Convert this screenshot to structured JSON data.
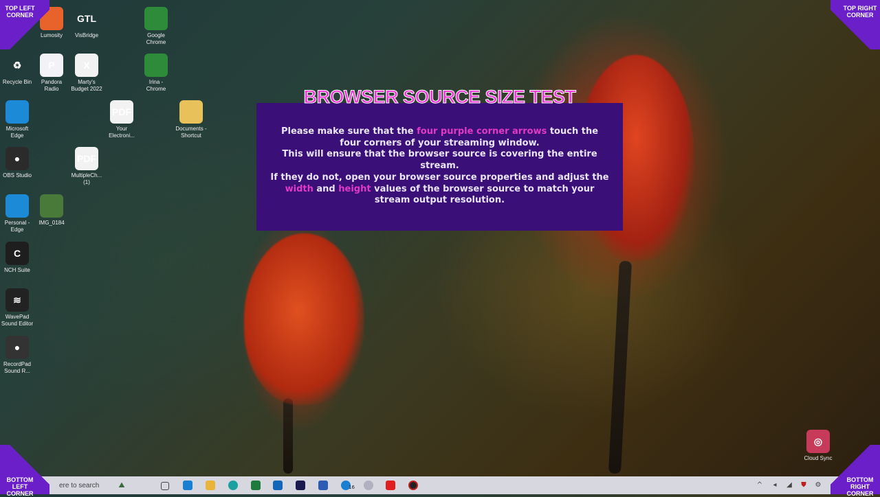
{
  "desktop_icons": [
    {
      "label": "Lumosity",
      "color": "#e8622b",
      "glyph": ""
    },
    {
      "label": "VisBridge",
      "color": "rgba(0,0,0,0)",
      "glyph": "GTL"
    },
    {
      "label": "Google Chrome",
      "color": "#2e8b3a",
      "glyph": ""
    },
    {
      "label": "Recycle Bin",
      "color": "rgba(0,0,0,0)",
      "glyph": "♻"
    },
    {
      "label": "Pandora Radio",
      "color": "#f2f2f7",
      "glyph": "P"
    },
    {
      "label": "Marty's Budget 2022",
      "color": "#f2f2f2",
      "glyph": "X"
    },
    {
      "label": "Irina - Chrome",
      "color": "#2e8b3a",
      "glyph": ""
    },
    {
      "label": "Microsoft Edge",
      "color": "#1c8ad6",
      "glyph": ""
    },
    {
      "label": "Your Electroni...",
      "color": "#f2f2f2",
      "glyph": "PDF"
    },
    {
      "label": "Documents - Shortcut",
      "color": "#e8c15a",
      "glyph": ""
    },
    {
      "label": "OBS Studio",
      "color": "#2b2b2b",
      "glyph": "●"
    },
    {
      "label": "MultipleCh... (1)",
      "color": "#f2f2f2",
      "glyph": "PDF"
    },
    {
      "label": "Personal - Edge",
      "color": "#1c8ad6",
      "glyph": ""
    },
    {
      "label": "IMG_0184",
      "color": "#4a7a3a",
      "glyph": ""
    },
    {
      "label": "NCH Suite",
      "color": "#1e1e1e",
      "glyph": "C"
    },
    {
      "label": "WavePad Sound Editor",
      "color": "#222",
      "glyph": "≋"
    },
    {
      "label": "RecordPad Sound R...",
      "color": "#333",
      "glyph": "●"
    },
    {
      "label": "Cloud Sync",
      "color": "#c83a5a",
      "glyph": "◎"
    }
  ],
  "corners": {
    "top_left": "TOP LEFT CORNER",
    "top_right": "TOP RIGHT CORNER",
    "bottom_left": "BOTTOM LEFT CORNER",
    "bottom_right": "BOTTOM RIGHT CORNER"
  },
  "test_overlay": {
    "title": "BROWSER SOURCE SIZE TEST",
    "p1_a": "Please make sure that the ",
    "p1_hl": "four purple corner arrows",
    "p1_b": " touch the four corners of your streaming window.",
    "p2": "This will ensure that the browser source is covering the entire stream.",
    "p3_a": "If they do not, open your browser source properties and adjust the ",
    "p3_hl1": "width",
    "p3_and": " and ",
    "p3_hl2": "height",
    "p3_b": " values of the browser source to match your stream output resolution."
  },
  "taskbar": {
    "search_placeholder": "ere to search",
    "badge": "16"
  },
  "colors": {
    "accent_purple": "#6a1fc9",
    "box_bg": "#3a0f78",
    "highlight": "#e13ac6"
  }
}
